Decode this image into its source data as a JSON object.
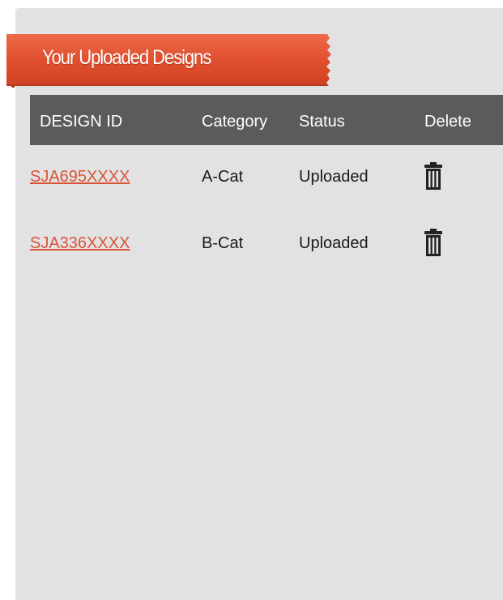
{
  "section": {
    "title": "Your Uploaded Designs"
  },
  "table": {
    "columns": [
      "DESIGN ID",
      "Category",
      "Status",
      "Delete"
    ],
    "rows": [
      {
        "design_id": "SJA695XXXX",
        "category": "A-Cat",
        "status": "Uploaded",
        "delete_icon": "trash-icon"
      },
      {
        "design_id": "SJA336XXXX",
        "category": "B-Cat",
        "status": "Uploaded",
        "delete_icon": "trash-icon"
      }
    ]
  },
  "colors": {
    "ribbon": "#e0502f",
    "ribbon_dark": "#9a2e15",
    "header_bg": "#5b5b5b",
    "link": "#d9553a",
    "panel_bg": "#e2e2e2"
  }
}
